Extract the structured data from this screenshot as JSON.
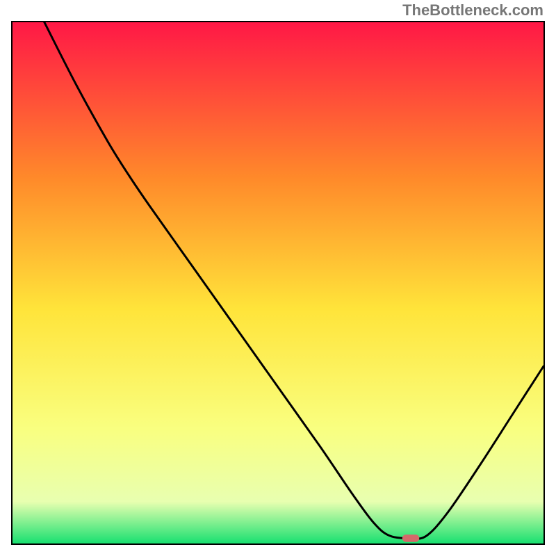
{
  "watermark": "TheBottleneck.com",
  "chart_data": {
    "type": "line",
    "title": "",
    "xlabel": "",
    "ylabel": "",
    "xlim": [
      0,
      100
    ],
    "ylim": [
      0,
      100
    ],
    "gradient_colors": {
      "top": "#ff1846",
      "mid_upper": "#ff8a2a",
      "mid": "#ffe43a",
      "mid_lower": "#f9ff80",
      "low": "#e8ffb0",
      "bottom": "#18e070"
    },
    "series": [
      {
        "name": "bottleneck-curve",
        "color": "#000000",
        "points": [
          {
            "x": 6.0,
            "y": 100.0
          },
          {
            "x": 12.0,
            "y": 88.0
          },
          {
            "x": 18.0,
            "y": 77.0
          },
          {
            "x": 22.0,
            "y": 70.5
          },
          {
            "x": 26.0,
            "y": 64.5
          },
          {
            "x": 34.0,
            "y": 53.0
          },
          {
            "x": 42.0,
            "y": 41.5
          },
          {
            "x": 50.0,
            "y": 30.0
          },
          {
            "x": 58.0,
            "y": 18.5
          },
          {
            "x": 64.0,
            "y": 9.5
          },
          {
            "x": 68.0,
            "y": 4.0
          },
          {
            "x": 71.0,
            "y": 1.5
          },
          {
            "x": 75.0,
            "y": 1.0
          },
          {
            "x": 78.0,
            "y": 1.5
          },
          {
            "x": 82.0,
            "y": 6.0
          },
          {
            "x": 88.0,
            "y": 15.0
          },
          {
            "x": 94.0,
            "y": 24.5
          },
          {
            "x": 100.0,
            "y": 34.0
          }
        ]
      }
    ],
    "marker": {
      "name": "optimal-marker",
      "x": 75.0,
      "y": 1.0,
      "color": "#d46a6a",
      "width_pct": 3.2,
      "height_pct": 1.4
    }
  }
}
